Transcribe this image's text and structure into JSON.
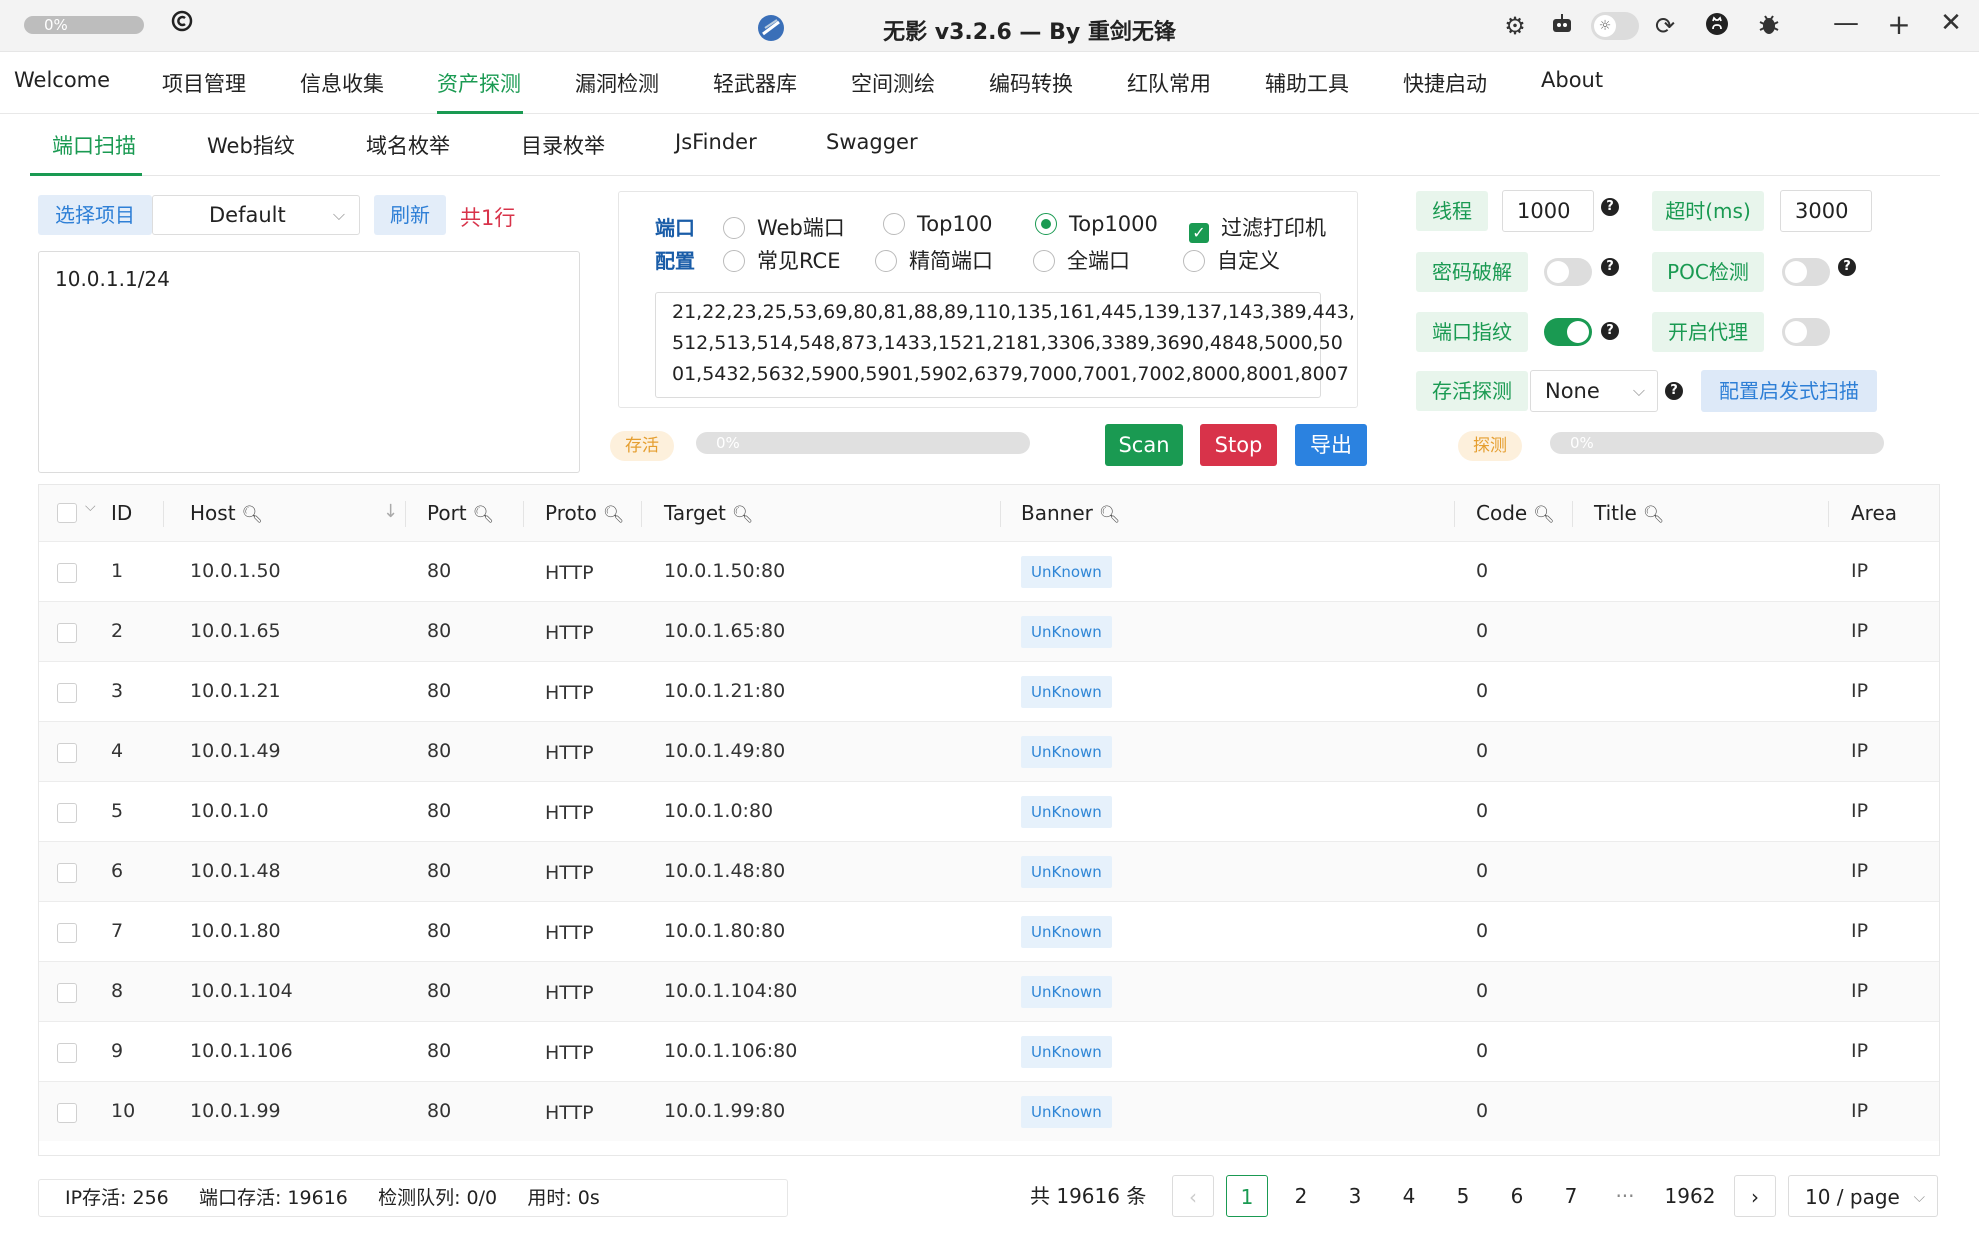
{
  "titlebar": {
    "progress_label": "0%",
    "title": "无影 v3.2.6 — By 重剑无锋",
    "icons": [
      "gear-icon",
      "robot-icon",
      "theme-toggle-icon",
      "refresh-icon",
      "github-icon",
      "bug-icon",
      "minimize-icon",
      "maximize-icon",
      "close-icon"
    ]
  },
  "main_menu": [
    "Welcome",
    "项目管理",
    "信息收集",
    "资产探测",
    "漏洞检测",
    "轻武器库",
    "空间测绘",
    "编码转换",
    "红队常用",
    "辅助工具",
    "快捷启动",
    "About"
  ],
  "main_menu_active": "资产探测",
  "sub_menu": [
    "端口扫描",
    "Web指纹",
    "域名枚举",
    "目录枚举",
    "JsFinder",
    "Swagger"
  ],
  "sub_menu_active": "端口扫描",
  "project": {
    "select_label": "选择项目",
    "selected": "Default",
    "refresh_label": "刷新",
    "line_count": "共1行",
    "targets": "10.0.1.1/24"
  },
  "port_config": {
    "label_line1": "端口",
    "label_line2": "配置",
    "options": [
      "Web端口",
      "Top100",
      "Top1000",
      "过滤打印机",
      "常见RCE",
      "精简端口",
      "全端口",
      "自定义"
    ],
    "selected": "Top1000",
    "filter_printer_checked": true,
    "ports_line1": "21,22,23,25,53,69,80,81,88,89,110,135,161,445,139,137,143,389,443,",
    "ports_line2": "512,513,514,548,873,1433,1521,2181,3306,3389,3690,4848,5000,50",
    "ports_line3": "01,5432,5632,5900,5901,5902,6379,7000,7001,7002,8000,8001,8007"
  },
  "settings": {
    "threads_label": "线程",
    "threads_value": "1000",
    "timeout_label": "超时(ms)",
    "timeout_value": "3000",
    "password_crack_label": "密码破解",
    "password_crack_on": false,
    "poc_label": "POC检测",
    "poc_on": false,
    "port_fp_label": "端口指纹",
    "port_fp_on": true,
    "proxy_label": "开启代理",
    "proxy_on": false,
    "alive_label": "存活探测",
    "alive_value": "None",
    "heuristic_label": "配置启发式扫描"
  },
  "progress": {
    "alive_tag": "存活",
    "alive_pct": "0%",
    "detect_tag": "探测",
    "detect_pct": "0%"
  },
  "actions": {
    "scan": "Scan",
    "stop": "Stop",
    "export": "导出"
  },
  "colors": {
    "accent": "#1a9a52",
    "scan": "#1a9a52",
    "stop": "#d8334a",
    "export": "#2b82e0"
  },
  "table": {
    "columns": [
      "ID",
      "Host",
      "Port",
      "Proto",
      "Target",
      "Banner",
      "Code",
      "Title",
      "Area"
    ],
    "rows": [
      {
        "id": "1",
        "host": "10.0.1.50",
        "port": "80",
        "proto": "HTTP",
        "target": "10.0.1.50:80",
        "banner": "UnKnown",
        "code": "0",
        "title": "",
        "area": "IP"
      },
      {
        "id": "2",
        "host": "10.0.1.65",
        "port": "80",
        "proto": "HTTP",
        "target": "10.0.1.65:80",
        "banner": "UnKnown",
        "code": "0",
        "title": "",
        "area": "IP"
      },
      {
        "id": "3",
        "host": "10.0.1.21",
        "port": "80",
        "proto": "HTTP",
        "target": "10.0.1.21:80",
        "banner": "UnKnown",
        "code": "0",
        "title": "",
        "area": "IP"
      },
      {
        "id": "4",
        "host": "10.0.1.49",
        "port": "80",
        "proto": "HTTP",
        "target": "10.0.1.49:80",
        "banner": "UnKnown",
        "code": "0",
        "title": "",
        "area": "IP"
      },
      {
        "id": "5",
        "host": "10.0.1.0",
        "port": "80",
        "proto": "HTTP",
        "target": "10.0.1.0:80",
        "banner": "UnKnown",
        "code": "0",
        "title": "",
        "area": "IP"
      },
      {
        "id": "6",
        "host": "10.0.1.48",
        "port": "80",
        "proto": "HTTP",
        "target": "10.0.1.48:80",
        "banner": "UnKnown",
        "code": "0",
        "title": "",
        "area": "IP"
      },
      {
        "id": "7",
        "host": "10.0.1.80",
        "port": "80",
        "proto": "HTTP",
        "target": "10.0.1.80:80",
        "banner": "UnKnown",
        "code": "0",
        "title": "",
        "area": "IP"
      },
      {
        "id": "8",
        "host": "10.0.1.104",
        "port": "80",
        "proto": "HTTP",
        "target": "10.0.1.104:80",
        "banner": "UnKnown",
        "code": "0",
        "title": "",
        "area": "IP"
      },
      {
        "id": "9",
        "host": "10.0.1.106",
        "port": "80",
        "proto": "HTTP",
        "target": "10.0.1.106:80",
        "banner": "UnKnown",
        "code": "0",
        "title": "",
        "area": "IP"
      },
      {
        "id": "10",
        "host": "10.0.1.99",
        "port": "80",
        "proto": "HTTP",
        "target": "10.0.1.99:80",
        "banner": "UnKnown",
        "code": "0",
        "title": "",
        "area": "IP"
      }
    ]
  },
  "status": {
    "ip_alive": "IP存活: 256",
    "port_alive": "端口存活: 19616",
    "queue": "检测队列: 0/0",
    "elapsed": "用时: 0s"
  },
  "pagination": {
    "total": "共 19616 条",
    "pages": [
      "1",
      "2",
      "3",
      "4",
      "5",
      "6",
      "7",
      "···",
      "1962"
    ],
    "current": "1",
    "page_size": "10 / page"
  }
}
